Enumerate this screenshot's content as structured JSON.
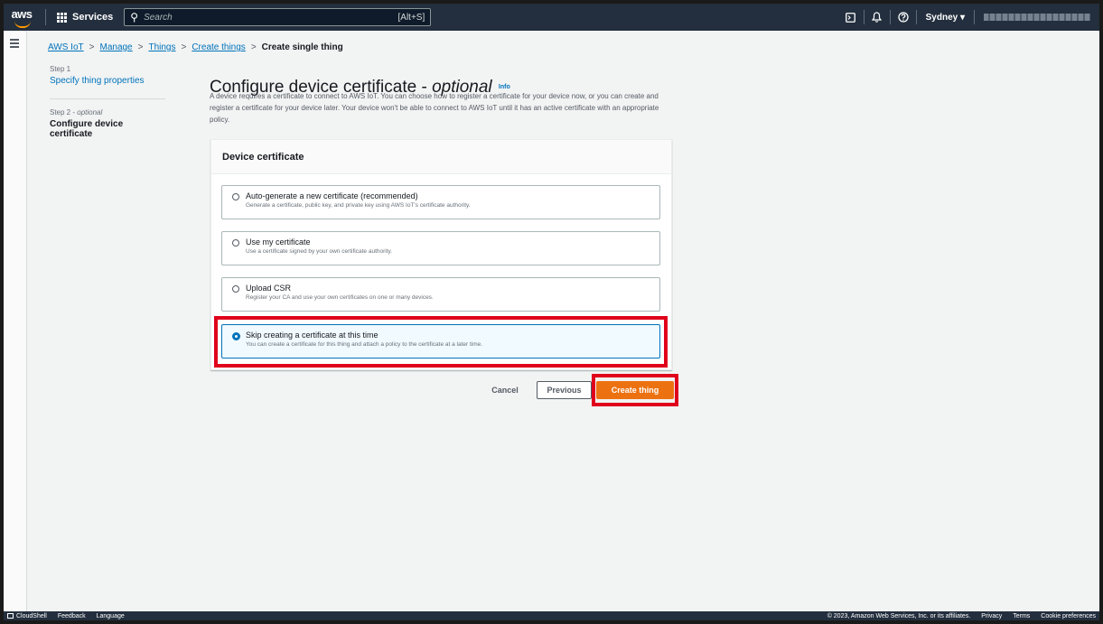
{
  "topnav": {
    "logo": "aws",
    "services_label": "Services",
    "search_placeholder": "Search",
    "search_shortcut": "[Alt+S]",
    "region_label": "Sydney ▾",
    "icons": [
      "cloudshell-icon",
      "bell-icon",
      "help-icon"
    ]
  },
  "breadcrumb": {
    "items": [
      "AWS IoT",
      "Manage",
      "Things",
      "Create things"
    ],
    "current": "Create single thing"
  },
  "steps": {
    "step1_label": "Step 1",
    "step1_link": "Specify thing properties",
    "step2_label": "Step 2 - ",
    "step2_optional": "optional",
    "step2_title": "Configure device certificate"
  },
  "header": {
    "title": "Configure device certificate - ",
    "title_optional": "optional",
    "info": "Info",
    "description": "A device requires a certificate to connect to AWS IoT. You can choose how to register a certificate for your device now, or you can create and register a certificate for your device later. Your device won't be able to connect to AWS IoT until it has an active certificate with an appropriate policy."
  },
  "certificate": {
    "heading": "Device certificate",
    "selected_index": 3,
    "options": [
      {
        "title": "Auto-generate a new certificate (recommended)",
        "description": "Generate a certificate, public key, and private key using AWS IoT's certificate authority."
      },
      {
        "title": "Use my certificate",
        "description": "Use a certificate signed by your own certificate authority."
      },
      {
        "title": "Upload CSR",
        "description": "Register your CA and use your own certificates on one or many devices."
      },
      {
        "title": "Skip creating a certificate at this time",
        "description": "You can create a certificate for this thing and attach a policy to the certificate at a later time."
      }
    ]
  },
  "actions": {
    "cancel": "Cancel",
    "previous": "Previous",
    "create": "Create thing"
  },
  "footer": {
    "cloudshell": "CloudShell",
    "feedback": "Feedback",
    "language": "Language",
    "copyright": "© 2023, Amazon Web Services, Inc. or its affiliates.",
    "privacy": "Privacy",
    "terms": "Terms",
    "cookie": "Cookie preferences"
  },
  "colors": {
    "nav_bg": "#232f3e",
    "link": "#0073bb",
    "primary_button": "#ec7211",
    "highlight": "#e0001b",
    "page_bg": "#f2f3f3"
  }
}
